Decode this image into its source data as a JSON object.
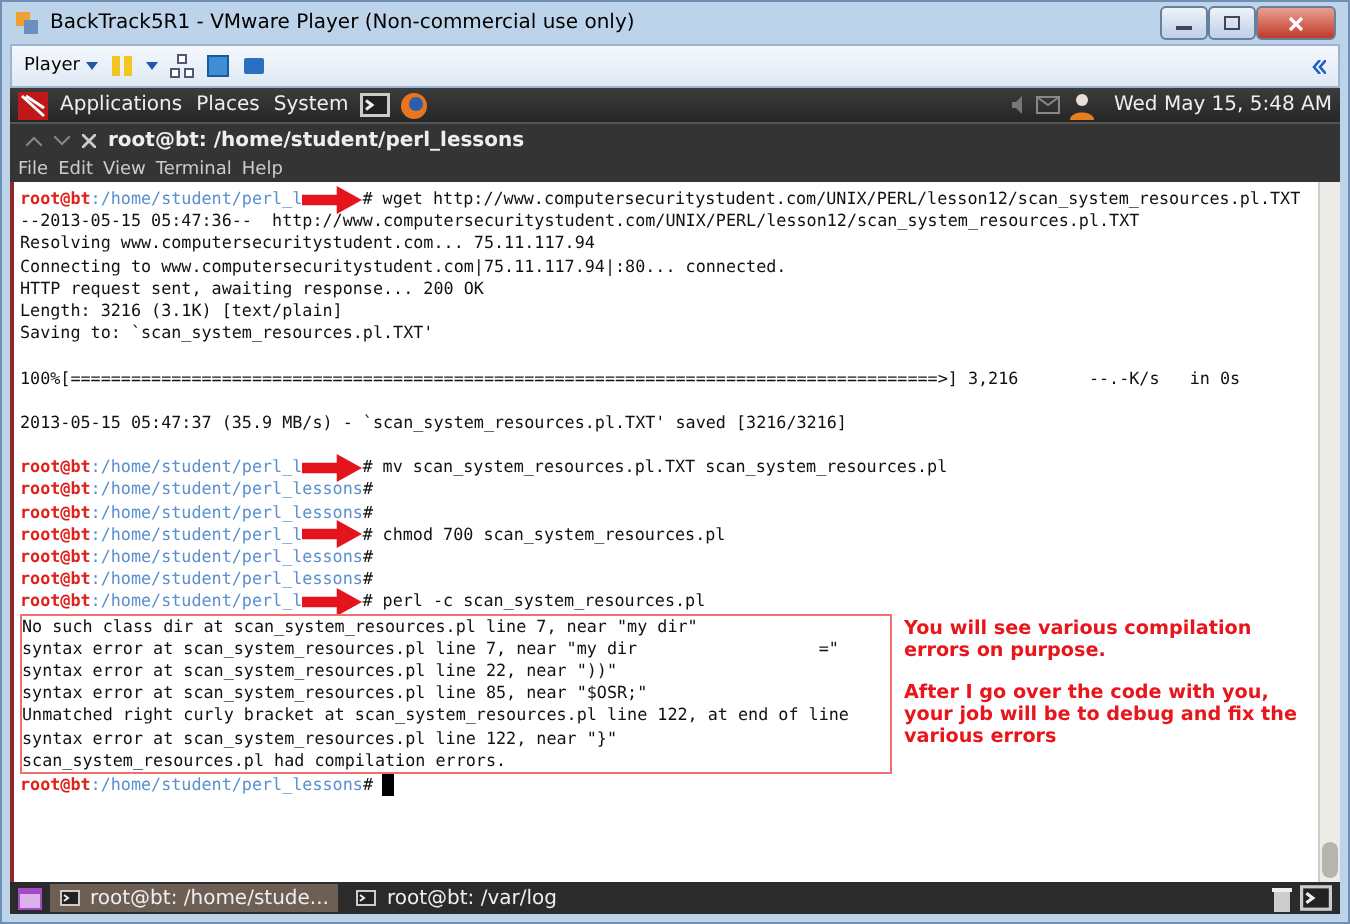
{
  "window": {
    "title": "BackTrack5R1 - VMware Player (Non-commercial use only)"
  },
  "toolbar": {
    "player_menu": "Player"
  },
  "panel": {
    "menus": [
      "Applications",
      "Places",
      "System"
    ],
    "clock": "Wed May 15,  5:48 AM"
  },
  "terminal": {
    "title": "root@bt: /home/student/perl_lessons",
    "menu": [
      "File",
      "Edit",
      "View",
      "Terminal",
      "Help"
    ],
    "lines": [
      {
        "kind": "prompt",
        "user": "root@bt",
        "path": ":/home/student/perl_l",
        "arrow": true,
        "command": "# wget http://www.computersecuritystudent.com/UNIX/PERL/lesson12/scan_system_resources.pl.TXT"
      },
      {
        "kind": "output",
        "text": "--2013-05-15 05:47:36--  http://www.computersecuritystudent.com/UNIX/PERL/lesson12/scan_system_resources.pl.TXT"
      },
      {
        "kind": "output",
        "text": "Resolving www.computersecuritystudent.com... 75.11.117.94"
      },
      {
        "kind": "output",
        "text": "Connecting to www.computersecuritystudent.com|75.11.117.94|:80... connected."
      },
      {
        "kind": "output",
        "text": "HTTP request sent, awaiting response... 200 OK"
      },
      {
        "kind": "output",
        "text": "Length: 3216 (3.1K) [text/plain]"
      },
      {
        "kind": "output",
        "text": "Saving to: `scan_system_resources.pl.TXT'"
      },
      {
        "kind": "blank"
      },
      {
        "kind": "output",
        "text": "100%[======================================================================================>] 3,216       --.-K/s   in 0s"
      },
      {
        "kind": "blank"
      },
      {
        "kind": "output",
        "text": "2013-05-15 05:47:37 (35.9 MB/s) - `scan_system_resources.pl.TXT' saved [3216/3216]"
      },
      {
        "kind": "blank"
      },
      {
        "kind": "prompt",
        "user": "root@bt",
        "path": ":/home/student/perl_l",
        "arrow": true,
        "command": "# mv scan_system_resources.pl.TXT scan_system_resources.pl"
      },
      {
        "kind": "prompt",
        "user": "root@bt",
        "path": ":/home/student/perl_lessons",
        "arrow": false,
        "command": "#"
      },
      {
        "kind": "prompt",
        "user": "root@bt",
        "path": ":/home/student/perl_lessons",
        "arrow": false,
        "command": "#"
      },
      {
        "kind": "prompt",
        "user": "root@bt",
        "path": ":/home/student/perl_l",
        "arrow": true,
        "command": "# chmod 700 scan_system_resources.pl"
      },
      {
        "kind": "prompt",
        "user": "root@bt",
        "path": ":/home/student/perl_lessons",
        "arrow": false,
        "command": "#"
      },
      {
        "kind": "prompt",
        "user": "root@bt",
        "path": ":/home/student/perl_lessons",
        "arrow": false,
        "command": "#"
      },
      {
        "kind": "prompt",
        "user": "root@bt",
        "path": ":/home/student/perl_l",
        "arrow": true,
        "command": "# perl -c scan_system_resources.pl"
      }
    ],
    "error_output": [
      "No such class dir at scan_system_resources.pl line 7, near \"my dir\"",
      "syntax error at scan_system_resources.pl line 7, near \"my dir                  =\"",
      "syntax error at scan_system_resources.pl line 22, near \"))\"",
      "syntax error at scan_system_resources.pl line 85, near \"$OSR;\"",
      "Unmatched right curly bracket at scan_system_resources.pl line 122, at end of line",
      "syntax error at scan_system_resources.pl line 122, near \"}\"",
      "scan_system_resources.pl had compilation errors."
    ],
    "final_prompt": {
      "user": "root@bt",
      "path": ":/home/student/perl_lessons",
      "command": "#",
      "cursor": true
    }
  },
  "annotation": [
    "You will see various compilation errors on purpose.",
    "After I go over the code with you, your job will be to debug and fix the various errors"
  ],
  "taskbar": [
    {
      "label": "root@bt: /home/stude...",
      "selected": true
    },
    {
      "label": "root@bt: /var/log",
      "selected": false
    }
  ]
}
